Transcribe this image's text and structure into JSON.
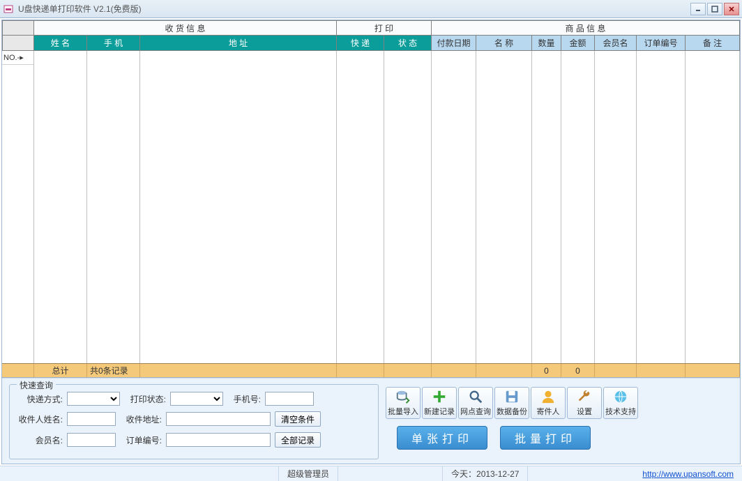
{
  "window": {
    "title": "U盘快递单打印软件 V2.1(免费版)"
  },
  "groups": {
    "receiving": "收 货 信 息",
    "print": "打 印",
    "product": "商 品 信 息"
  },
  "cols": {
    "name": "姓 名",
    "phone": "手 机",
    "address": "地 址",
    "express": "快 递",
    "status": "状 态",
    "paydate": "付款日期",
    "prodname": "名 称",
    "qty": "数量",
    "amount": "金额",
    "member": "会员名",
    "orderno": "订单编号",
    "remark": "备 注"
  },
  "row_indicator": "NO.-▸",
  "footer": {
    "total": "总计",
    "count": "共0条记录",
    "qty": "0",
    "amount": "0"
  },
  "query": {
    "legend": "快速查询",
    "express": "快递方式:",
    "status": "打印状态:",
    "phone": "手机号:",
    "recipient": "收件人姓名:",
    "address": "收件地址:",
    "member": "会员名:",
    "orderno": "订单编号:",
    "clear": "清空条件",
    "all": "全部记录"
  },
  "tools": {
    "import": "批量导入",
    "new": "新建记录",
    "netquery": "网点查询",
    "backup": "数据备份",
    "sender": "寄件人",
    "settings": "设置",
    "support": "技术支持"
  },
  "bigbuttons": {
    "single": "单张打印",
    "batch": "批量打印"
  },
  "status": {
    "user": "超级管理员",
    "today_label": "今天：",
    "today": "2013-12-27",
    "url": "http://www.upansoft.com"
  },
  "widths": {
    "rownum": 46,
    "name": 76,
    "phone": 76,
    "address": 282,
    "express": 68,
    "status": 68,
    "paydate": 64,
    "prodname": 80,
    "qty": 42,
    "amount": 48,
    "member": 60,
    "orderno": 70,
    "remark": 52
  }
}
